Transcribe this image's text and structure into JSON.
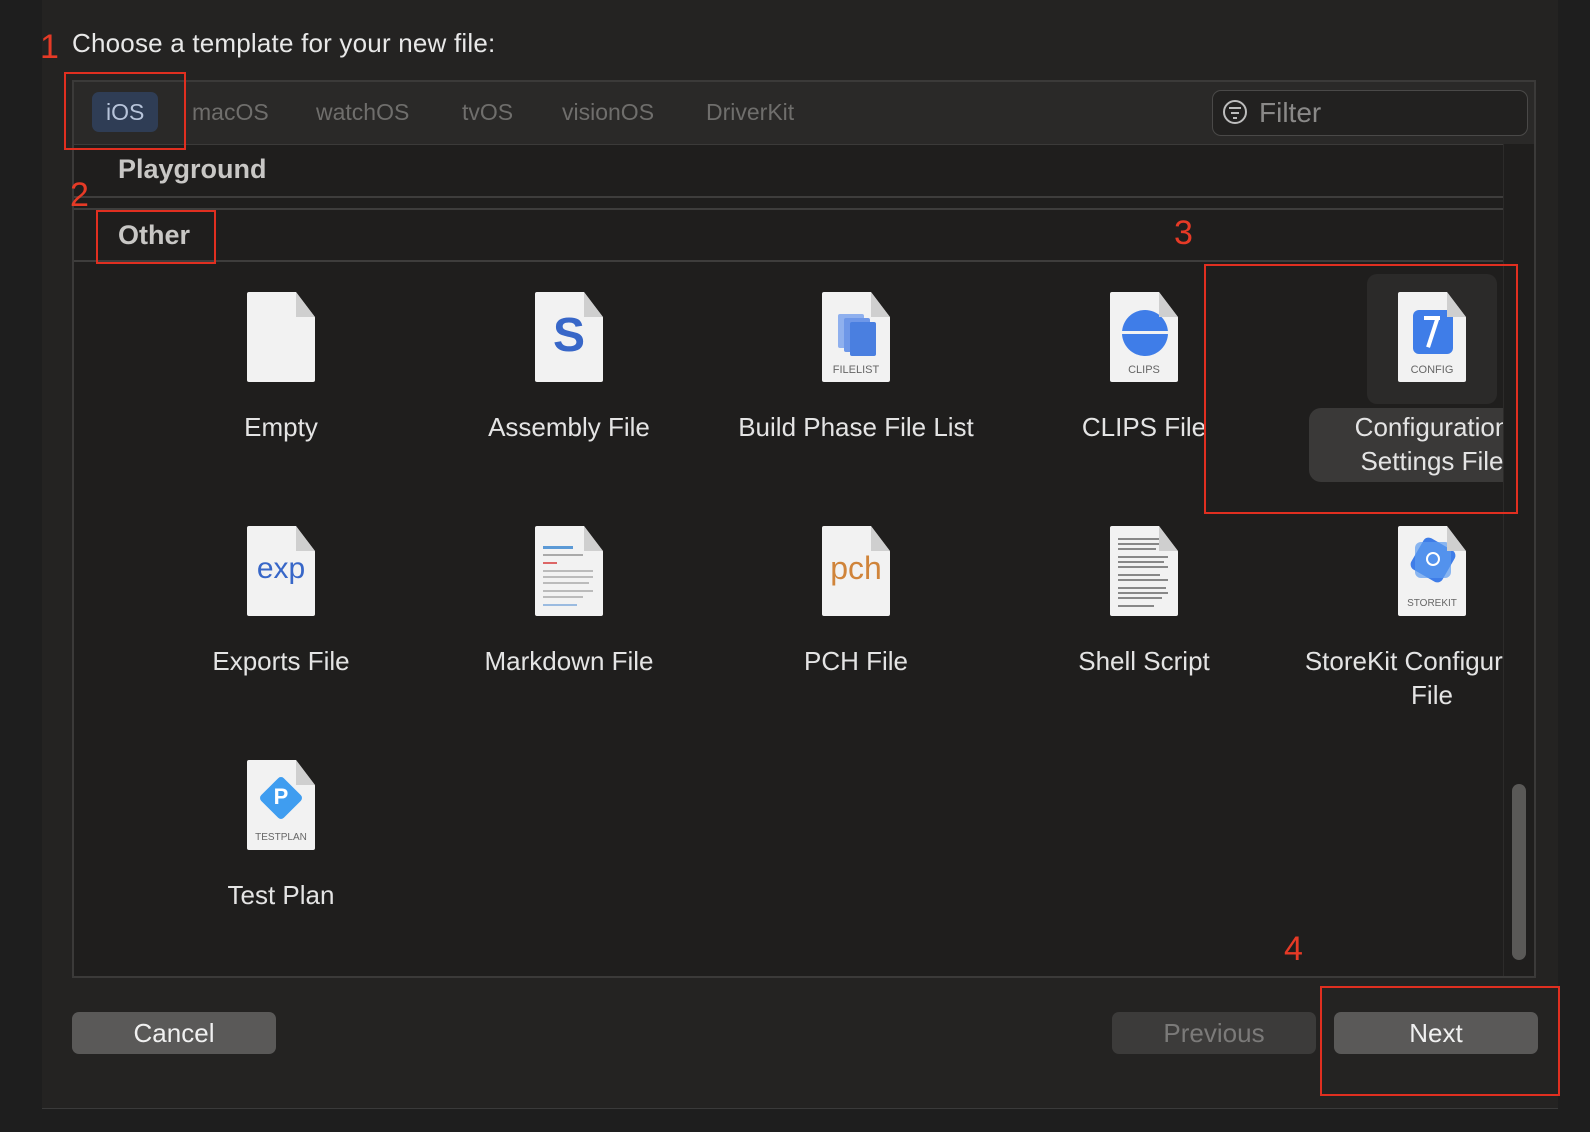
{
  "dialog": {
    "title": "Choose a template for your new file:"
  },
  "platform_tabs": [
    {
      "label": "iOS",
      "selected": true
    },
    {
      "label": "macOS",
      "selected": false
    },
    {
      "label": "watchOS",
      "selected": false
    },
    {
      "label": "tvOS",
      "selected": false
    },
    {
      "label": "visionOS",
      "selected": false
    },
    {
      "label": "DriverKit",
      "selected": false
    }
  ],
  "filter": {
    "placeholder": "Filter",
    "icon": "filter-icon"
  },
  "sections": [
    {
      "label": "Playground"
    },
    {
      "label": "Other"
    }
  ],
  "templates": [
    {
      "label": "Empty",
      "icon": "empty-doc-icon",
      "badge": ""
    },
    {
      "label": "Assembly File",
      "icon": "assembly-doc-icon",
      "badge": "S"
    },
    {
      "label": "Build Phase File List",
      "icon": "filelist-doc-icon",
      "badge": "FILELIST"
    },
    {
      "label": "CLIPS File",
      "icon": "clips-doc-icon",
      "badge": "CLIPS"
    },
    {
      "label": "Configuration Settings File",
      "icon": "config-doc-icon",
      "badge": "CONFIG",
      "selected": true
    },
    {
      "label": "Exports File",
      "icon": "exports-doc-icon",
      "badge": "exp"
    },
    {
      "label": "Markdown File",
      "icon": "markdown-doc-icon",
      "badge": ""
    },
    {
      "label": "PCH File",
      "icon": "pch-doc-icon",
      "badge": "pch"
    },
    {
      "label": "Shell Script",
      "icon": "shell-doc-icon",
      "badge": ""
    },
    {
      "label": "StoreKit Configuration File",
      "icon": "storekit-doc-icon",
      "badge": "STOREKIT"
    },
    {
      "label": "Test Plan",
      "icon": "testplan-doc-icon",
      "badge": "TESTPLAN",
      "letter": "P"
    }
  ],
  "buttons": {
    "cancel": "Cancel",
    "previous": "Previous",
    "next": "Next"
  },
  "annotations": [
    "1",
    "2",
    "3",
    "4"
  ],
  "colors": {
    "annotation_red": "#e02f20",
    "accent_blue": "#3f7de8",
    "selected_tab_bg": "#2f3d55"
  }
}
